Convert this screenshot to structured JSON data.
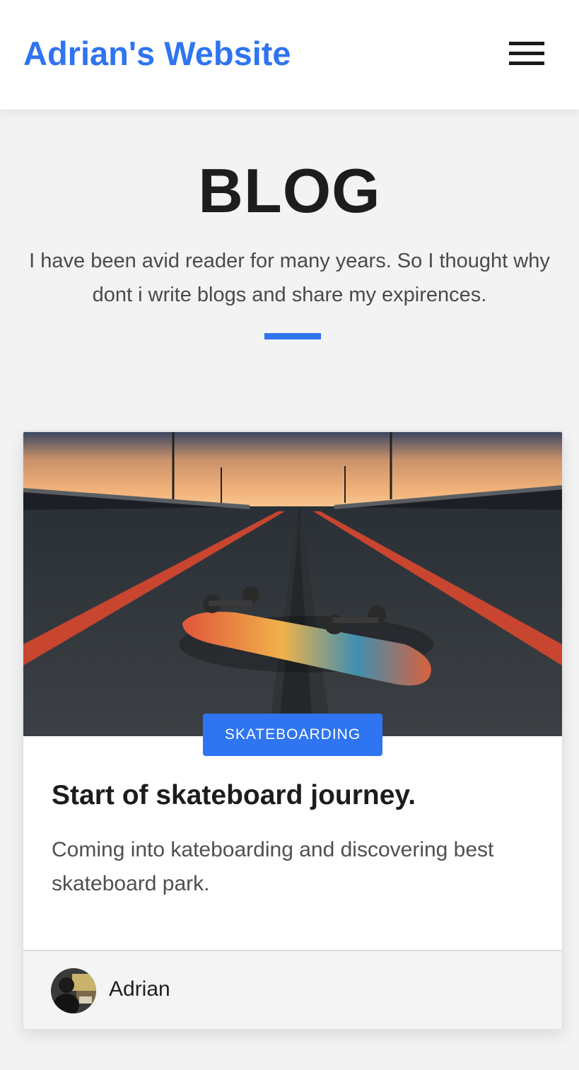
{
  "header": {
    "site_title": "Adrian's Website",
    "menu_icon": "hamburger-menu-icon",
    "brand_color": "#2f74f0"
  },
  "hero": {
    "title": "BLOG",
    "subtitle": "I have been avid reader for many years. So I thought why dont i write blogs and share my expirences."
  },
  "posts": [
    {
      "category": "SKATEBOARDING",
      "title": "Start of skateboard journey.",
      "excerpt": "Coming into kateboarding and discovering best skateboard park.",
      "author": "Adrian",
      "image": "skateboard-on-road-photo",
      "avatar": "author-avatar-photo"
    }
  ]
}
